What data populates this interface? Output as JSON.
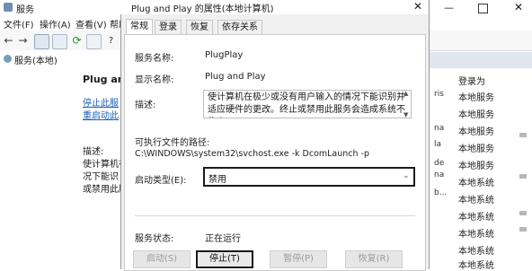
{
  "bg_window": {
    "title": "服务",
    "menu": [
      "文件(F)",
      "操作(A)",
      "查看(V)",
      "帮助(H)"
    ],
    "tree_item": "服务(本地)",
    "header_label": "服务",
    "middle_lines": [
      "Plug and",
      "停止此服",
      "重启动此",
      "描述:",
      "使计算机在",
      "况下能识",
      "或禁用此服"
    ],
    "list_header": "登录为",
    "list_col_small": [
      "ris",
      "na",
      "la",
      "de",
      "na",
      "b..."
    ],
    "list_items": [
      "本地服务",
      "本地服务",
      "本地服务",
      "本地服务",
      "本地服务",
      "本地系统",
      "本地系统",
      "本地系统",
      "本地系统",
      "本地系统",
      "本地系统",
      "本地系统",
      "本地系统",
      "本地系统",
      "本地系统"
    ]
  },
  "dialog": {
    "title": "Plug and Play 的属性(本地计算机)",
    "tabs": [
      "常规",
      "登录",
      "恢复",
      "依存关系"
    ],
    "service_name_label": "服务名称:",
    "service_name": "PlugPlay",
    "display_name_label": "显示名称:",
    "display_name": "Plug and Play",
    "description_label": "描述:",
    "description": "使计算机在极少或没有用户输入的情况下能识别并适应硬件的更改。终止或禁用此服务会造成系统不稳定。",
    "exe_path_label": "可执行文件的路径:",
    "exe_path": "C:\\WINDOWS\\system32\\svchost.exe -k DcomLaunch -p",
    "startup_type_label": "启动类型(E):",
    "startup_type": "禁用",
    "status_label": "服务状态:",
    "status_value": "正在运行",
    "buttons": {
      "start": "启动(S)",
      "stop": "停止(T)",
      "pause": "暂停(P)",
      "resume": "恢复(R)"
    }
  }
}
